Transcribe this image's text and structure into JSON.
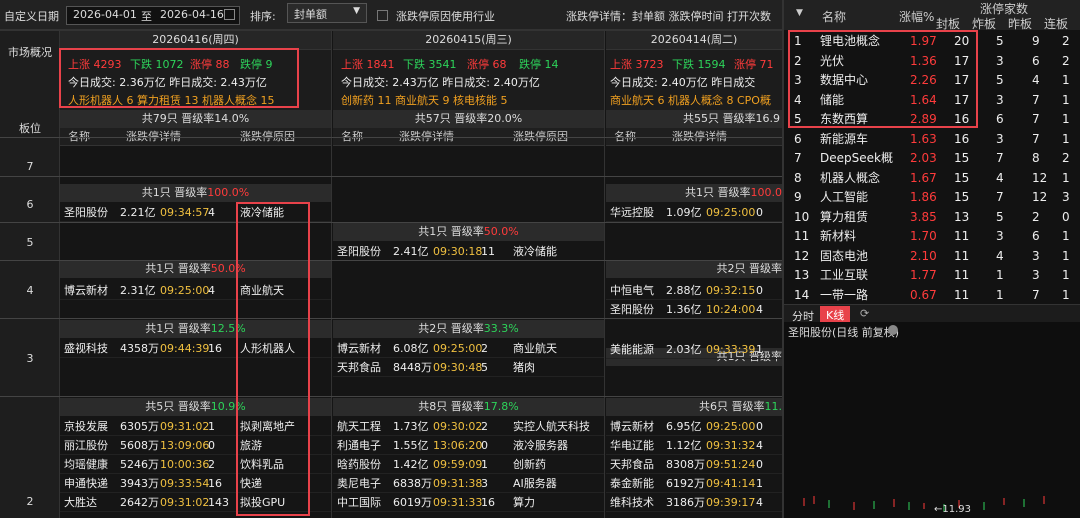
{
  "toolbar": {
    "custom_date_label": "自定义日期",
    "date_from": "2026-04-01",
    "to_label": "至",
    "date_to": "2026-04-16",
    "sort_label": "排序:",
    "sort_value": "封单额",
    "reason_industry_label": "涨跌停原因使用行业",
    "detail_label": "涨跌停详情：封单额 涨跌停时间 打开次数"
  },
  "left": {
    "market_overview": "市场概况",
    "board_level": "板位",
    "levels": [
      "7",
      "6",
      "5",
      "4",
      "3",
      "2"
    ]
  },
  "days": [
    {
      "date": "20260416(周四)",
      "stats": {
        "up": "上涨 4293",
        "down": "下跌 1072",
        "limit_up": "涨停 88",
        "limit_down": "跌停 9"
      },
      "vol": "今日成交: 2.36万亿  昨日成交: 2.43万亿",
      "hot": "人形机器人 6  算力租赁 13  机器人概念 15",
      "total": "共79只 晋级率14.0%",
      "th": {
        "name": "名称",
        "detail": "涨跌停详情",
        "reason": "涨跌停原因"
      },
      "groups": {
        "g6": {
          "count": "共1只 晋级率",
          "rate": "100.0%"
        },
        "g4": {
          "count": "共1只 晋级率",
          "rate": "50.0%"
        },
        "g3": {
          "count": "共1只 晋级率",
          "rate": "12.5%"
        },
        "g2": {
          "count": "共5只 晋级率",
          "rate": "10.9%"
        }
      },
      "rows6": [
        [
          "圣阳股份",
          "2.21亿",
          "09:34:57",
          "4",
          "液冷储能"
        ]
      ],
      "rows4": [
        [
          "博云新材",
          "2.31亿",
          "09:25:00",
          "4",
          "商业航天"
        ]
      ],
      "rows3": [
        [
          "盛视科技",
          "4358万",
          "09:44:39",
          "16",
          "人形机器人"
        ]
      ],
      "rows2": [
        [
          "京投发展",
          "6305万",
          "09:31:02",
          "1",
          "拟剥离地产"
        ],
        [
          "丽江股份",
          "5608万",
          "13:09:06",
          "0",
          "旅游"
        ],
        [
          "均瑶健康",
          "5246万",
          "10:00:36",
          "2",
          "饮料乳品"
        ],
        [
          "申通快递",
          "3943万",
          "09:33:54",
          "16",
          "快递"
        ],
        [
          "大胜达",
          "2642万",
          "09:31:02",
          "143",
          "拟投GPU"
        ]
      ]
    },
    {
      "date": "20260415(周三)",
      "stats": {
        "up": "上涨 1841",
        "down": "下跌 3541",
        "limit_up": "涨停 68",
        "limit_down": "跌停 14"
      },
      "vol": "今日成交: 2.43万亿  昨日成交: 2.40万亿",
      "hot": "创新药 11  商业航天 9  核电核能 5",
      "total": "共57只 晋级率20.0%",
      "th": {
        "name": "名称",
        "detail": "涨跌停详情",
        "reason": "涨跌停原因"
      },
      "groups": {
        "g5": {
          "count": "共1只 晋级率",
          "rate": "50.0%"
        },
        "g3": {
          "count": "共2只 晋级率",
          "rate": "33.3%"
        },
        "g2": {
          "count": "共8只 晋级率",
          "rate": "17.8%"
        }
      },
      "rows5": [
        [
          "圣阳股份",
          "2.41亿",
          "09:30:18",
          "11",
          "液冷储能"
        ]
      ],
      "rows3": [
        [
          "博云新材",
          "6.08亿",
          "09:25:00",
          "2",
          "商业航天"
        ],
        [
          "天邦食品",
          "8448万",
          "09:30:48",
          "5",
          "猪肉"
        ]
      ],
      "rows2": [
        [
          "航天工程",
          "1.73亿",
          "09:30:02",
          "2",
          "实控人航天科技"
        ],
        [
          "利通电子",
          "1.55亿",
          "13:06:20",
          "0",
          "液冷服务器"
        ],
        [
          "晗药股份",
          "1.42亿",
          "09:59:09",
          "1",
          "创新药"
        ],
        [
          "奥尼电子",
          "6838万",
          "09:31:38",
          "3",
          "AI服务器"
        ],
        [
          "中工国际",
          "6019万",
          "09:31:33",
          "16",
          "算力"
        ]
      ]
    },
    {
      "date": "20260414(周二)",
      "stats": {
        "up": "上涨 3723",
        "down": "下跌 1594",
        "limit_up": "涨停 71"
      },
      "vol": "今日成交: 2.40万亿  昨日成交",
      "hot": "商业航天 6  机器人概念 8  CPO概",
      "total": "共55只 晋级率16.9",
      "th": {
        "name": "名称",
        "detail": "涨跌停详情"
      },
      "groups": {
        "g6": {
          "count": "共1只 晋级率",
          "rate": "100.0"
        },
        "g4": {
          "count": "共2只 晋级率",
          "rate": ""
        },
        "g3": {
          "count": "共1只 晋级率",
          "rate": ""
        },
        "g2": {
          "count": "共6只 晋级率",
          "rate": "11."
        }
      },
      "rows6": [
        [
          "华远控股",
          "1.09亿",
          "09:25:00",
          "0"
        ]
      ],
      "rows4": [
        [
          "中恒电气",
          "2.88亿",
          "09:32:15",
          "0"
        ],
        [
          "圣阳股份",
          "1.36亿",
          "10:24:00",
          "4"
        ]
      ],
      "rows3": [
        [
          "美能能源",
          "2.03亿",
          "09:33:39",
          "1"
        ]
      ],
      "rows2": [
        [
          "博云新材",
          "6.95亿",
          "09:25:00",
          "0"
        ],
        [
          "华电辽能",
          "1.12亿",
          "09:31:32",
          "4"
        ],
        [
          "天邦食品",
          "8308万",
          "09:51:24",
          "0"
        ],
        [
          "泰金新能",
          "6192万",
          "09:41:14",
          "1"
        ],
        [
          "维科技术",
          "3186万",
          "09:39:17",
          "4"
        ]
      ]
    }
  ],
  "right": {
    "header": {
      "name": "名称",
      "pct": "涨幅%",
      "group": "涨停家数",
      "seal": "封板",
      "broken": "炸板",
      "yesterday": "昨板",
      "cons": "连板"
    },
    "rows": [
      [
        "1",
        "锂电池概念",
        "1.97",
        "20",
        "5",
        "9",
        "2"
      ],
      [
        "2",
        "光伏",
        "1.36",
        "17",
        "3",
        "6",
        "2"
      ],
      [
        "3",
        "数据中心",
        "2.26",
        "17",
        "5",
        "4",
        "1"
      ],
      [
        "4",
        "储能",
        "1.64",
        "17",
        "3",
        "7",
        "1"
      ],
      [
        "5",
        "东数西算",
        "2.89",
        "16",
        "6",
        "7",
        "1"
      ],
      [
        "6",
        "新能源车",
        "1.63",
        "16",
        "3",
        "7",
        "1"
      ],
      [
        "7",
        "DeepSeek概",
        "2.03",
        "15",
        "7",
        "8",
        "2"
      ],
      [
        "8",
        "机器人概念",
        "1.67",
        "15",
        "4",
        "12",
        "1"
      ],
      [
        "9",
        "人工智能",
        "1.86",
        "15",
        "7",
        "12",
        "3"
      ],
      [
        "10",
        "算力租赁",
        "3.85",
        "13",
        "5",
        "2",
        "0"
      ],
      [
        "11",
        "新材料",
        "1.70",
        "11",
        "3",
        "6",
        "1"
      ],
      [
        "12",
        "固态电池",
        "2.10",
        "11",
        "4",
        "3",
        "1"
      ],
      [
        "13",
        "工业互联",
        "1.77",
        "11",
        "1",
        "3",
        "1"
      ],
      [
        "14",
        "一带一路",
        "0.67",
        "11",
        "1",
        "7",
        "1"
      ]
    ],
    "tabs": {
      "time": "分时",
      "kline": "K线"
    },
    "stock_label": "圣阳股份(日线 前复权)",
    "price_low": "11.93",
    "colors": {
      "accent_red": "#e8424a",
      "up": "#ff3b3b",
      "down": "#2dd35a"
    }
  }
}
